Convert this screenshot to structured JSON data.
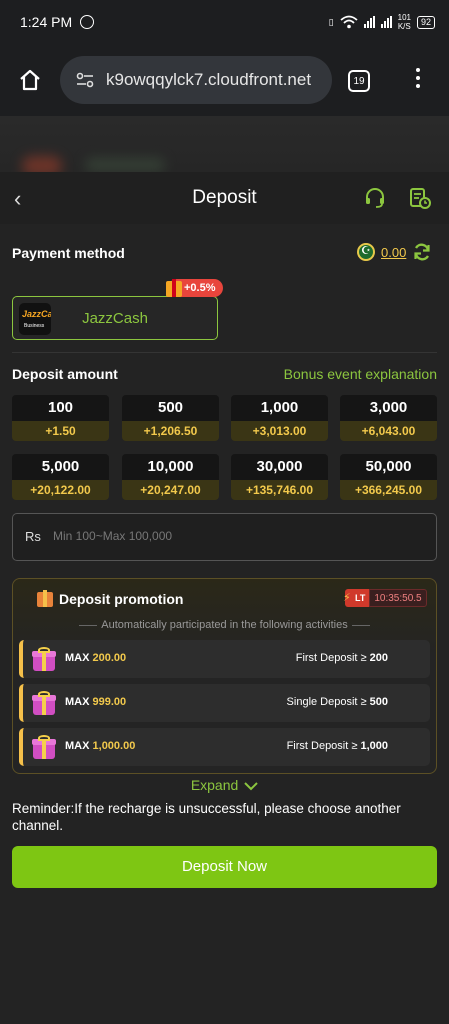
{
  "status": {
    "time": "1:24 PM",
    "net_speed_top": "101",
    "net_speed_unit": "K/S",
    "battery": "92"
  },
  "browser": {
    "url": "k9owqqylck7.cloudfront.net",
    "tab_count": "19"
  },
  "header": {
    "title": "Deposit"
  },
  "payment": {
    "label": "Payment method",
    "balance": "0.00",
    "method_name": "JazzCash",
    "method_logo_text": "JazzCash",
    "method_logo_sub": "Business",
    "bonus_badge": "+0.5%"
  },
  "deposit": {
    "label": "Deposit amount",
    "explain_link": "Bonus event explanation",
    "amounts": [
      {
        "value": "100",
        "bonus": "+1.50"
      },
      {
        "value": "500",
        "bonus": "+1,206.50"
      },
      {
        "value": "1,000",
        "bonus": "+3,013.00"
      },
      {
        "value": "3,000",
        "bonus": "+6,043.00"
      },
      {
        "value": "5,000",
        "bonus": "+20,122.00"
      },
      {
        "value": "10,000",
        "bonus": "+20,247.00"
      },
      {
        "value": "30,000",
        "bonus": "+135,746.00"
      },
      {
        "value": "50,000",
        "bonus": "+366,245.00"
      }
    ],
    "currency": "Rs",
    "placeholder": "Min 100~Max 100,000"
  },
  "promotion": {
    "title": "Deposit promotion",
    "lt_label": "LT",
    "countdown": "10:35:50.5",
    "note": "Automatically participated in the following activities",
    "rows": [
      {
        "max_label": "MAX",
        "max_value": "200.00",
        "cond_label": "First Deposit ≥",
        "cond_value": "200"
      },
      {
        "max_label": "MAX",
        "max_value": "999.00",
        "cond_label": "Single Deposit ≥",
        "cond_value": "500"
      },
      {
        "max_label": "MAX",
        "max_value": "1,000.00",
        "cond_label": "First Deposit ≥",
        "cond_value": "1,000"
      }
    ],
    "expand_label": "Expand"
  },
  "reminder": "Reminder:If the recharge is unsuccessful, please choose another channel.",
  "submit_label": "Deposit Now",
  "colors": {
    "accent": "#8cc63f",
    "bonus_gold": "#f2c94c",
    "button": "#7ec613"
  }
}
